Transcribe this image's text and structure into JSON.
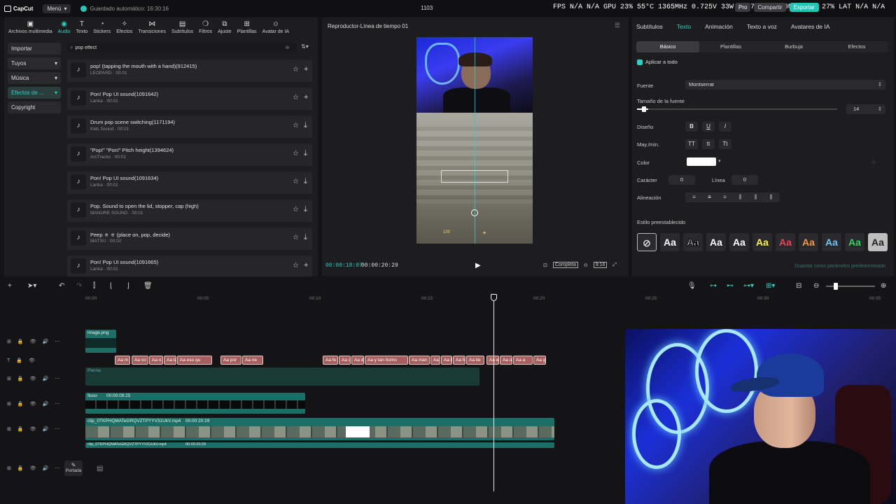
{
  "topbar": {
    "app_name": "CapCut",
    "menu_label": "Menú",
    "autosave": "Guardado automático: 16:30:16",
    "project_title": "1103",
    "stats": "FPS N/A N/A   GPU 23% 55°C 1365MHz 0.725V 33W 1137RPM 7200MHz   CPU 27%   LAT N/A N/A",
    "pro_label": "Pro",
    "share_label": "Compartir",
    "export_label": "Exportar"
  },
  "media": {
    "tabs": [
      {
        "label": "Archivos multimedia",
        "icon": "film-icon"
      },
      {
        "label": "Audio",
        "icon": "audio-icon"
      },
      {
        "label": "Texto",
        "icon": "text-icon"
      },
      {
        "label": "Stickers",
        "icon": "sticker-icon"
      },
      {
        "label": "Efectos",
        "icon": "effects-icon"
      },
      {
        "label": "Transiciones",
        "icon": "transition-icon"
      },
      {
        "label": "Subtítulos",
        "icon": "subtitles-icon"
      },
      {
        "label": "Filtros",
        "icon": "filter-icon"
      },
      {
        "label": "Ajuste",
        "icon": "adjust-icon"
      },
      {
        "label": "Plantillas",
        "icon": "templates-icon"
      },
      {
        "label": "Avatar de IA",
        "icon": "avatar-icon"
      }
    ],
    "side_nav": [
      "Importar",
      "Tuyos",
      "Música",
      "Efectos de ...",
      "Copyright"
    ],
    "search_value": "pop effect",
    "sounds": [
      {
        "title": "pop! (tapping the mouth with a hand)(912415)",
        "meta": "LEOPARD · 00:01",
        "action": "+"
      },
      {
        "title": "Pon! Pop UI sound(1091642)",
        "meta": "Lanka · 00:01",
        "action": "+"
      },
      {
        "title": "Drum pop scene switching(1171194)",
        "meta": "Kids Sound · 00:01",
        "action": "⤓"
      },
      {
        "title": "\"Pop!\" \"Pon!\" Pitch height(1394624)",
        "meta": "ArcTracks · 00:01",
        "action": "⤓"
      },
      {
        "title": "Pon! Pop UI sound(1091634)",
        "meta": "Lanka · 00:01",
        "action": "⤓"
      },
      {
        "title": "Pop. Sound to open the lid, stopper, cap (high)",
        "meta": "MANURE SOUND · 00:01",
        "action": "⤓"
      },
      {
        "title": "Peep ㅎ ㅎ (place on, pop, decide)",
        "meta": "MATSU · 00:02",
        "action": "⤓"
      },
      {
        "title": "Pon! Pop UI sound(1091665)",
        "meta": "Lanka · 00:01",
        "action": "+"
      }
    ]
  },
  "player": {
    "title": "Reproductor-Línea de tiempo 01",
    "current_time": "00:00:18:07",
    "total_time": "00:00:20:29",
    "completa_label": "Completa",
    "ratio_label": "9:16",
    "badge_text": "100"
  },
  "props": {
    "tabs": [
      "Subtítulos",
      "Texto",
      "Animación",
      "Texto a voz",
      "Avatares de IA"
    ],
    "sub_tabs": [
      "Básico",
      "Plantillas",
      "Burbuja",
      "Efectos"
    ],
    "apply_all": "Aplicar a todo",
    "font_label": "Fuente",
    "font_value": "Montserrat",
    "size_label": "Tamaño de la fuente",
    "size_value": "14",
    "size_fraction": 0.07,
    "design_label": "Diseño",
    "case_label": "May./min.",
    "color_label": "Color",
    "char_label": "Carácter",
    "char_value": "0",
    "line_label": "Línea",
    "line_value": "0",
    "align_label": "Alineación",
    "preset_label": "Estilo preestablecido",
    "save_default": "Guardar como parámetro predeterminado",
    "design_buttons": [
      "B",
      "U",
      "I"
    ],
    "case_buttons": [
      "TT",
      "tt",
      "Tt"
    ],
    "presets": [
      {
        "label": "Aa",
        "color": "#ffffff"
      },
      {
        "label": "Aa",
        "color": "#ffffff"
      },
      {
        "label": "Aa",
        "color": "#ffffff"
      },
      {
        "label": "Aa",
        "color": "#ffffff"
      },
      {
        "label": "Aa",
        "color": "#f6f34a"
      },
      {
        "label": "Aa",
        "color": "#e8455a"
      },
      {
        "label": "Aa",
        "color": "#f19a3e"
      },
      {
        "label": "Aa",
        "color": "#6ec3f5"
      },
      {
        "label": "Aa",
        "color": "#35d158"
      },
      {
        "label": "Aa",
        "color": "#222222"
      }
    ]
  },
  "timeline": {
    "ticks": [
      "00:00",
      "00:05",
      "00:10",
      "00:15",
      "00:20",
      "00:25",
      "00:30",
      "00:35"
    ],
    "image_clip_label": "image.png",
    "audio_clip_label": "Pierna",
    "effect_clip_label": "Iluso",
    "effect_clip_time": "00:00:09:25",
    "main_clip_label": "clip_0TKPHQMATeGRQVZTPYYV31UkV.mp4",
    "main_clip_time": "00:00:20:29",
    "main_clip2_label": "clip_0TKPHQMATeGRQVZTPYYV31UkV.mp4",
    "main_clip2_time": "00:00:20:29",
    "cover_label": "Portada",
    "text_clips": [
      "Aa m",
      "Aa co",
      "Aa o",
      "Aa ta",
      "Aa eso qu",
      "Aa por",
      "Aa ne",
      "Aa fe",
      "Aa al",
      "Aa di",
      "Aa y tan homo",
      "Aa man",
      "Aa en",
      "Aa la",
      "Aa fe",
      "Aa tie",
      "Aa el",
      "Aa u",
      "Aa a",
      "Aa gay"
    ]
  }
}
